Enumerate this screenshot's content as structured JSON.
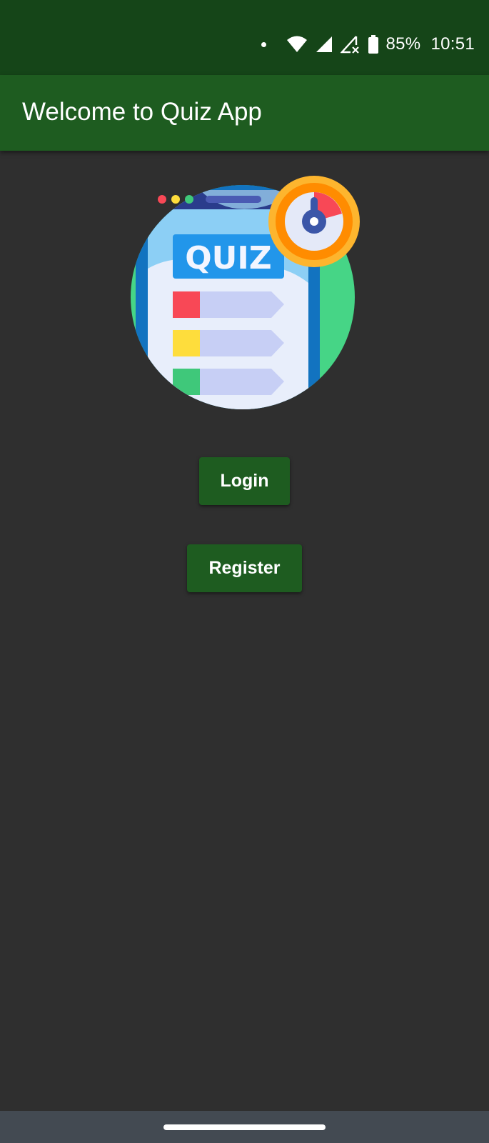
{
  "status_bar": {
    "battery": "85%",
    "time": "10:51",
    "icons": [
      "notification-dot-icon",
      "wifi-icon",
      "signal-icon",
      "no-signal-icon",
      "battery-icon"
    ]
  },
  "app_bar": {
    "title": "Welcome to Quiz App"
  },
  "logo": {
    "text": "QUIZ",
    "icon": "quiz-stopwatch-logo"
  },
  "buttons": {
    "login": "Login",
    "register": "Register"
  },
  "colors": {
    "status_bar": "#154518",
    "app_bar": "#1e5c20",
    "background": "#2f2f2f",
    "button": "#1e5c20",
    "nav_bar": "#434a52"
  }
}
